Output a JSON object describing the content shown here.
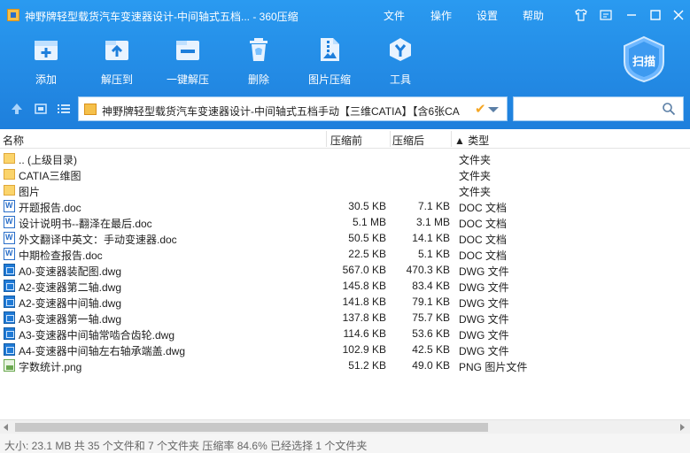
{
  "window": {
    "title": "神野牌轻型载货汽车变速器设计-中间轴式五档... - 360压缩",
    "menu": [
      "文件",
      "操作",
      "设置",
      "帮助"
    ]
  },
  "toolbar": {
    "items": [
      {
        "label": "添加",
        "icon": "add-icon"
      },
      {
        "label": "解压到",
        "icon": "extract-to-icon"
      },
      {
        "label": "一键解压",
        "icon": "one-click-extract-icon"
      },
      {
        "label": "删除",
        "icon": "delete-icon"
      },
      {
        "label": "图片压缩",
        "icon": "image-compress-icon"
      },
      {
        "label": "工具",
        "icon": "tools-icon"
      }
    ],
    "scan_label": "扫描"
  },
  "address": {
    "path": "神野牌轻型载货汽车变速器设计-中间轴式五档手动【三维CATIA】【含6张CA",
    "search_placeholder": ""
  },
  "columns": {
    "name": "名称",
    "compressed_before": "压缩前",
    "compressed_after": "压缩后",
    "type": "▲ 类型"
  },
  "files": [
    {
      "name": ".. (上级目录)",
      "size": "",
      "packed": "",
      "type": "文件夹",
      "kind": "folder"
    },
    {
      "name": "CATIA三维图",
      "size": "",
      "packed": "",
      "type": "文件夹",
      "kind": "folder"
    },
    {
      "name": "图片",
      "size": "",
      "packed": "",
      "type": "文件夹",
      "kind": "folder"
    },
    {
      "name": "开题报告.doc",
      "size": "30.5 KB",
      "packed": "7.1 KB",
      "type": "DOC 文档",
      "kind": "doc"
    },
    {
      "name": "设计说明书--翻泽在最后.doc",
      "size": "5.1 MB",
      "packed": "3.1 MB",
      "type": "DOC 文档",
      "kind": "doc"
    },
    {
      "name": "外文翻译中英文：手动变速器.doc",
      "size": "50.5 KB",
      "packed": "14.1 KB",
      "type": "DOC 文档",
      "kind": "doc"
    },
    {
      "name": "中期检查报告.doc",
      "size": "22.5 KB",
      "packed": "5.1 KB",
      "type": "DOC 文档",
      "kind": "doc"
    },
    {
      "name": "A0-变速器装配图.dwg",
      "size": "567.0 KB",
      "packed": "470.3 KB",
      "type": "DWG 文件",
      "kind": "dwg"
    },
    {
      "name": "A2-变速器第二轴.dwg",
      "size": "145.8 KB",
      "packed": "83.4 KB",
      "type": "DWG 文件",
      "kind": "dwg"
    },
    {
      "name": "A2-变速器中间轴.dwg",
      "size": "141.8 KB",
      "packed": "79.1 KB",
      "type": "DWG 文件",
      "kind": "dwg"
    },
    {
      "name": "A3-变速器第一轴.dwg",
      "size": "137.8 KB",
      "packed": "75.7 KB",
      "type": "DWG 文件",
      "kind": "dwg"
    },
    {
      "name": "A3-变速器中间轴常啮合齿轮.dwg",
      "size": "114.6 KB",
      "packed": "53.6 KB",
      "type": "DWG 文件",
      "kind": "dwg"
    },
    {
      "name": "A4-变速器中间轴左右轴承端盖.dwg",
      "size": "102.9 KB",
      "packed": "42.5 KB",
      "type": "DWG 文件",
      "kind": "dwg"
    },
    {
      "name": "字数统计.png",
      "size": "51.2 KB",
      "packed": "49.0 KB",
      "type": "PNG 图片文件",
      "kind": "png"
    }
  ],
  "status": "大小: 23.1 MB 共 35 个文件和 7 个文件夹 压缩率 84.6% 已经选择 1 个文件夹"
}
